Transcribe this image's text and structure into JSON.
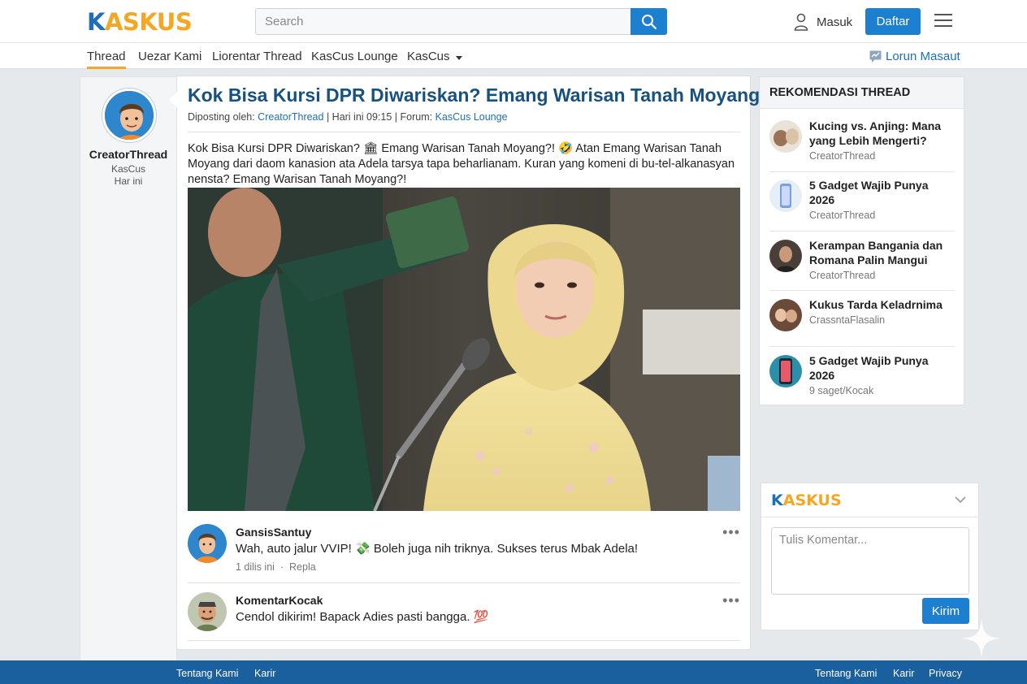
{
  "header": {
    "logo": "KASKUS",
    "search_placeholder": "Search",
    "login_label": "Masuk",
    "register_label": "Daftar"
  },
  "nav": {
    "items": [
      "Thread",
      "Uezar Kami",
      "Liorentar Thread",
      "KasCus Lounge",
      "KasCus"
    ],
    "right_label": "Lorun Masaut"
  },
  "author": {
    "name": "CreatorThread",
    "community": "KasCus",
    "time": "Har ini"
  },
  "post": {
    "title": "Kok Bisa Kursi DPR Diwariskan? Emang Warisan Tanah Moyang?! 🤣",
    "meta_prefix": "Diposting oleh: ",
    "meta_author": "CreatorThread",
    "meta_middle": " | Hari ini 09:15 | Forum: ",
    "meta_forum": "KasCus Lounge",
    "body": "Kok Bisa Kursi DPR Diwariskan? 🏛 Emang Warisan Tanah Moyang?! 🤣 Atan Emang Warisan Tanah Moyang dari daom kanasion ata Adela tarsya tapa beharlianam. Kuran yang komeni di bu-tel-alkanasyan nensta? Emang Warisan Tanah Moyang?!"
  },
  "comments": [
    {
      "name": "GansisSantuy",
      "text": "Wah, auto jalur VVIP! 💸 Boleh juga nih triknya. Sukses terus Mbak Adela!",
      "time": "1 dilis ini",
      "reply": "Repla"
    },
    {
      "name": "KomentarKocak",
      "text": "Cendol dikirim! Bapack Adies pasti bangga. 💯"
    }
  ],
  "recommendations": {
    "heading": "REKOMENDASI THREAD",
    "items": [
      {
        "title": "Kucing vs. Anjing: Mana yang Lebih Mengerti?",
        "author": "CreatorThread"
      },
      {
        "title": "5 Gadget Wajib Punya 2026",
        "author": "CreatorThread"
      },
      {
        "title": "Kerampan Bangania dan Romana Palin Mangui",
        "author": "CreatorThread"
      },
      {
        "title": "Kukus Tarda Keladrnima",
        "author": "CrassntaFlasalin"
      },
      {
        "title": "5 Gadget Wajib Punya 2026",
        "author": "9 saget/Kocak"
      }
    ]
  },
  "widget": {
    "logo": "KASKUS",
    "placeholder": "Tulis Komentar...",
    "send_label": "Kirim"
  },
  "footer": {
    "left": [
      "Tentang Kami",
      "Karir"
    ],
    "right": [
      "Tentang Kami",
      "Karir",
      "Privacy"
    ]
  },
  "colors": {
    "brand_blue": "#1d6fb8",
    "brand_orange": "#f5a623",
    "button_blue": "#1d7fcf",
    "footer_blue": "#1a5f9e"
  }
}
